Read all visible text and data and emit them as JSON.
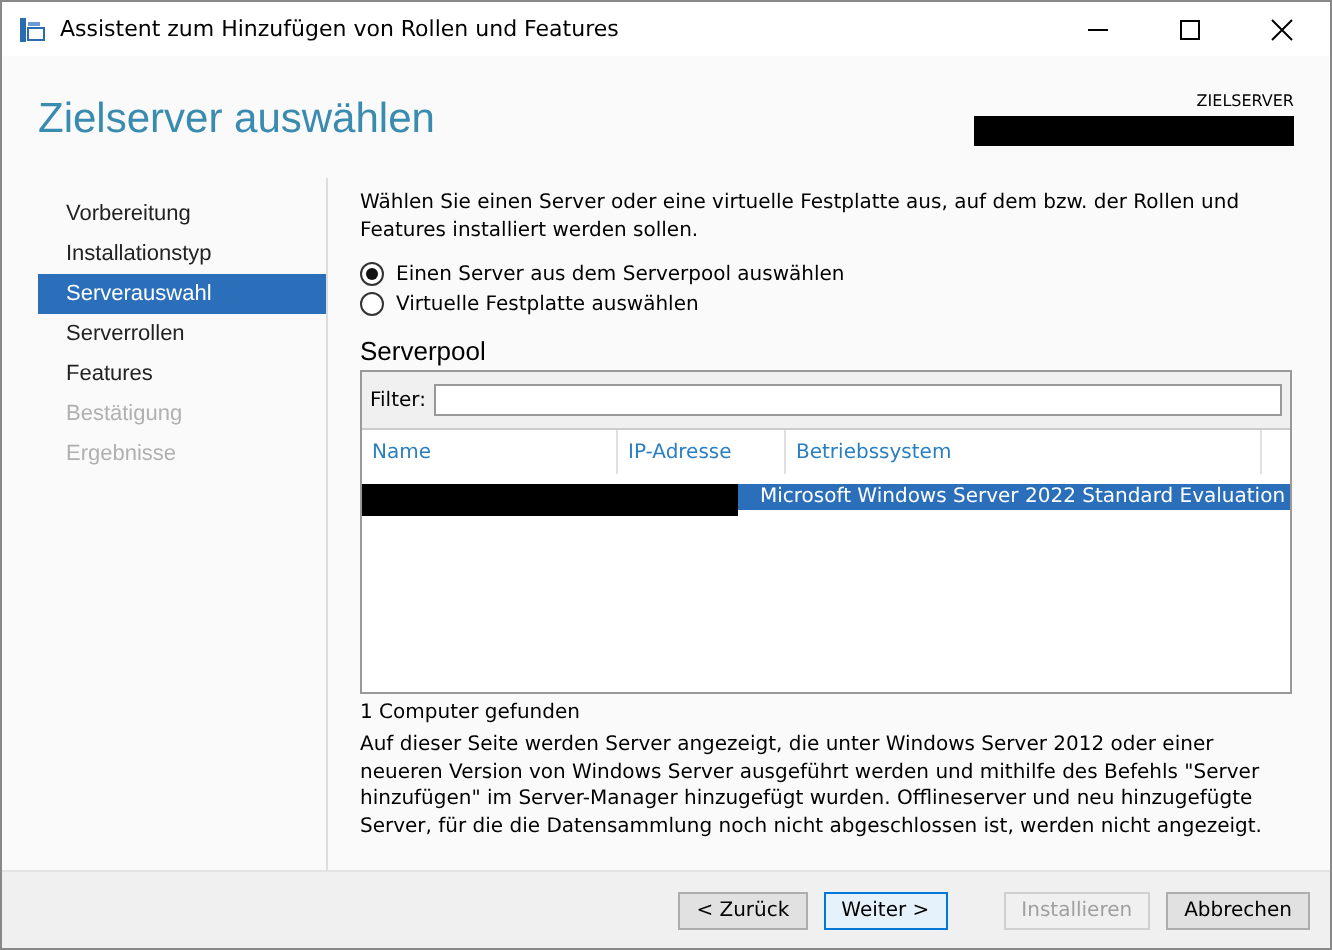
{
  "window": {
    "title": "Assistent zum Hinzufügen von Rollen und Features"
  },
  "header": {
    "title": "Zielserver auswählen",
    "target_label": "ZIELSERVER",
    "target_redacted": true
  },
  "sidebar": {
    "items": [
      {
        "label": "Vorbereitung",
        "selected": false,
        "disabled": false
      },
      {
        "label": "Installationstyp",
        "selected": false,
        "disabled": false
      },
      {
        "label": "Serverauswahl",
        "selected": true,
        "disabled": false
      },
      {
        "label": "Serverrollen",
        "selected": false,
        "disabled": false
      },
      {
        "label": "Features",
        "selected": false,
        "disabled": false
      },
      {
        "label": "Bestätigung",
        "selected": false,
        "disabled": true
      },
      {
        "label": "Ergebnisse",
        "selected": false,
        "disabled": true
      }
    ]
  },
  "intro": "Wählen Sie einen Server oder eine virtuelle Festplatte aus, auf dem bzw. der Rollen und Features installiert werden sollen.",
  "options": [
    {
      "label": "Einen Server aus dem Serverpool auswählen",
      "selected": true
    },
    {
      "label": "Virtuelle Festplatte auswählen",
      "selected": false
    }
  ],
  "serverpool": {
    "title": "Serverpool",
    "filter_label": "Filter:",
    "columns": [
      "Name",
      "IP-Adresse",
      "Betriebssystem"
    ],
    "rows": [
      {
        "redacted": true,
        "os": "Microsoft Windows Server 2022 Standard Evaluation",
        "selected": true
      }
    ],
    "count": "1 Computer gefunden"
  },
  "note": "Auf dieser Seite werden Server angezeigt, die unter Windows Server 2012 oder einer neueren Version von Windows Server ausgeführt werden und mithilfe des Befehls \"Server hinzufügen\" im Server-Manager hinzugefügt wurden. Offlineserver und neu hinzugefügte Server, für die die Datensammlung noch nicht abgeschlossen ist, werden nicht angezeigt.",
  "buttons": [
    {
      "label": "< Zurück",
      "disabled": false,
      "default": false
    },
    {
      "label": "Weiter >",
      "disabled": false,
      "default": true
    },
    {
      "label": "Installieren",
      "disabled": true,
      "default": false
    },
    {
      "label": "Abbrechen",
      "disabled": false,
      "default": false
    }
  ]
}
